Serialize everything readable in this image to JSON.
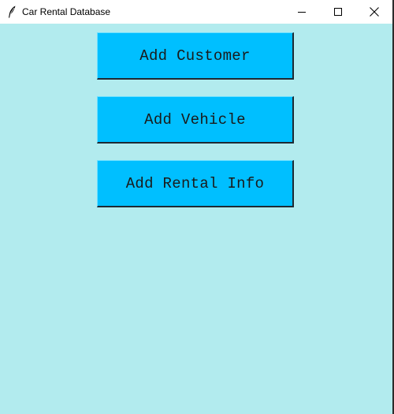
{
  "window": {
    "title": "Car Rental Database",
    "icon": "feather-icon"
  },
  "controls": {
    "minimize_icon": "minimize-icon",
    "maximize_icon": "maximize-icon",
    "close_icon": "close-icon"
  },
  "buttons": [
    {
      "label": "Add Customer"
    },
    {
      "label": "Add Vehicle"
    },
    {
      "label": "Add Rental Info"
    }
  ],
  "colors": {
    "background": "#b2ebee",
    "button": "#00bfff",
    "titlebar": "#ffffff"
  }
}
